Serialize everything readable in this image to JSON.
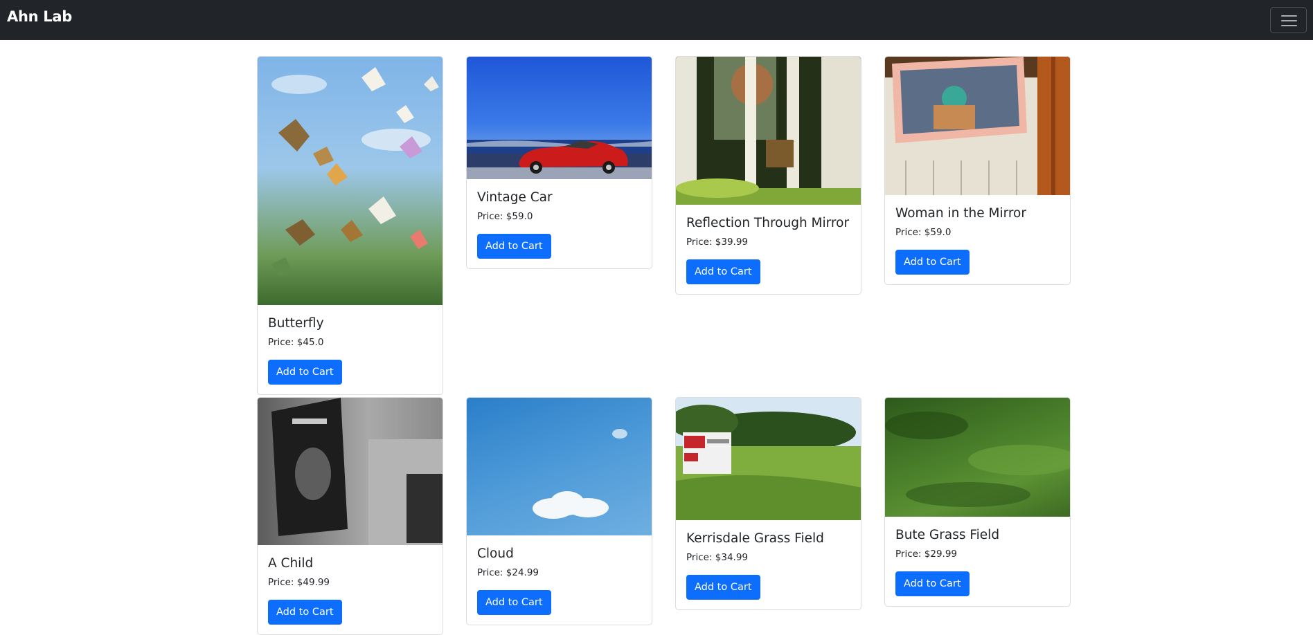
{
  "brand": "Ahn Lab",
  "products": [
    {
      "title": "Butterfly",
      "price": "Price: $45.0",
      "button": "Add to Cart"
    },
    {
      "title": "Vintage Car",
      "price": "Price: $59.0",
      "button": "Add to Cart"
    },
    {
      "title": "Reflection Through Mirror",
      "price": "Price: $39.99",
      "button": "Add to Cart"
    },
    {
      "title": "Woman in the Mirror",
      "price": "Price: $59.0",
      "button": "Add to Cart"
    },
    {
      "title": "A Child",
      "price": "Price: $49.99",
      "button": "Add to Cart"
    },
    {
      "title": "Cloud",
      "price": "Price: $24.99",
      "button": "Add to Cart"
    },
    {
      "title": "Kerrisdale Grass Field",
      "price": "Price: $34.99",
      "button": "Add to Cart"
    },
    {
      "title": "Bute Grass Field",
      "price": "Price: $29.99",
      "button": "Add to Cart"
    }
  ],
  "colors": {
    "navbar": "#212529",
    "button": "#0d6efd"
  }
}
